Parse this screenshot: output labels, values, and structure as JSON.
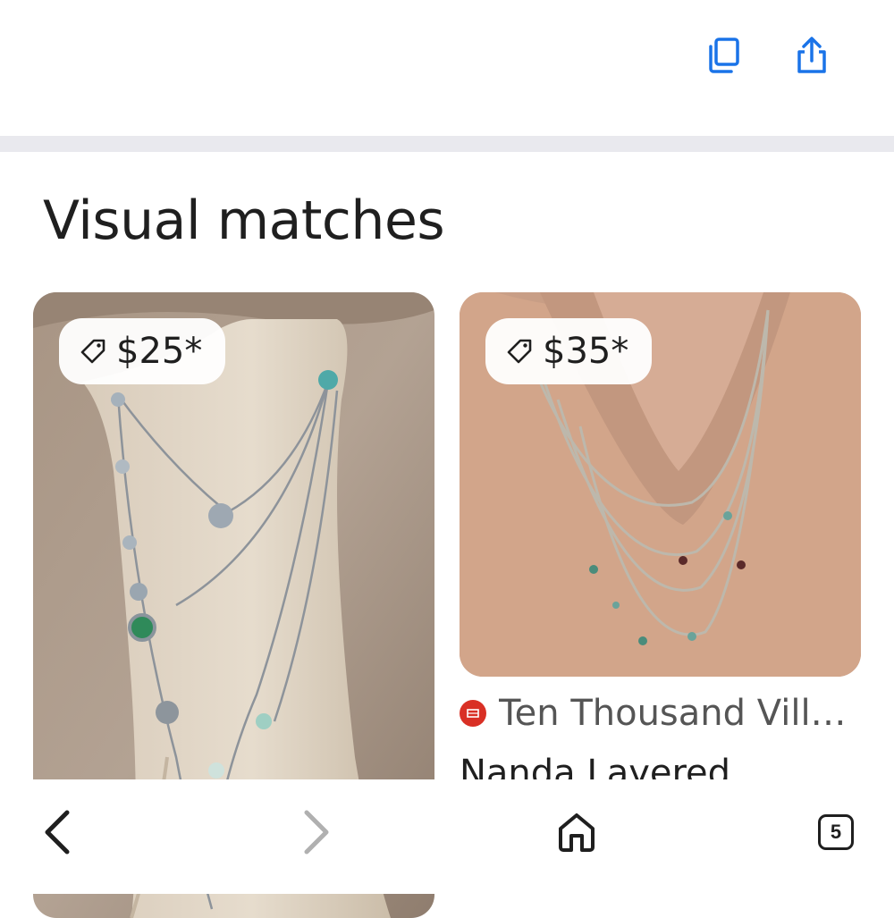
{
  "header": {
    "icons": [
      "copy-icon",
      "share-icon"
    ],
    "accent_color": "#1a73e8"
  },
  "section": {
    "title": "Visual matches"
  },
  "results": [
    {
      "price": "$25*",
      "image": "silver layered necklace on beige bust"
    },
    {
      "price": "$35*",
      "source": "Ten Thousand Vill…",
      "title": "Nanda Layered",
      "image": "layered gold necklaces on peach blouse"
    }
  ],
  "bottom_nav": {
    "tab_count": "5",
    "icons": [
      "back-icon",
      "forward-icon",
      "home-icon",
      "tabs-icon"
    ]
  }
}
